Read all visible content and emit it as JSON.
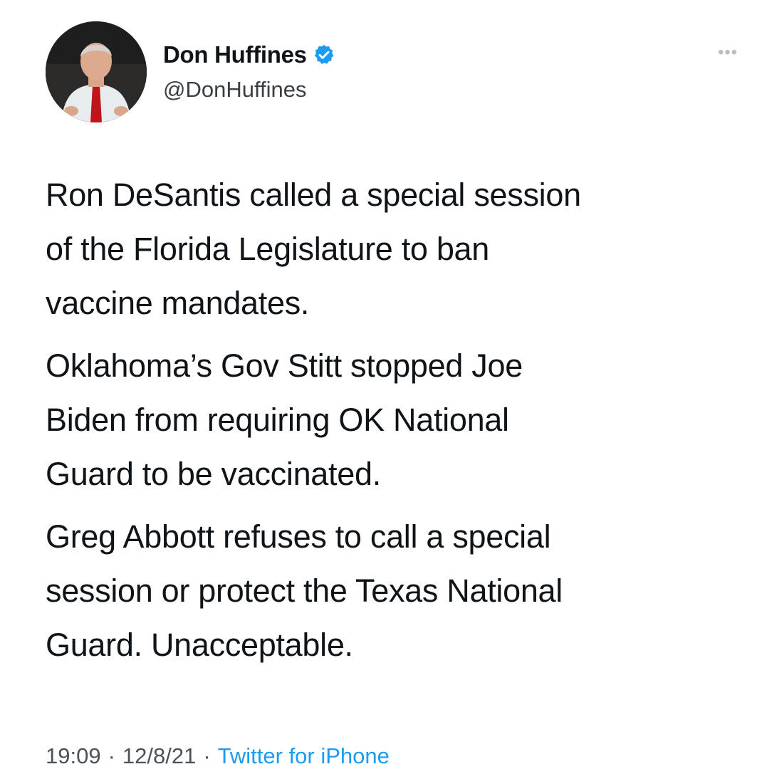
{
  "author": {
    "display_name": "Don Huffines",
    "handle": "@DonHuffines",
    "verified_icon": "verified-badge-icon",
    "avatar_icon": "avatar-photo"
  },
  "more_icon": "ellipsis-icon",
  "tweet": {
    "paragraphs": [
      "Ron DeSantis called a special session\nof the Florida Legislature to ban\nvaccine mandates.",
      "Oklahoma’s Gov Stitt stopped Joe\nBiden from requiring OK National\nGuard to be vaccinated.",
      "Greg Abbott refuses to call a special\nsession or protect the Texas National\nGuard. Unacceptable."
    ]
  },
  "meta": {
    "time": "19:09",
    "separator": "·",
    "date": "12/8/21",
    "source": "Twitter for iPhone"
  },
  "colors": {
    "link": "#1d9bf0",
    "text": "#0f1419",
    "secondary": "#4b5358"
  }
}
